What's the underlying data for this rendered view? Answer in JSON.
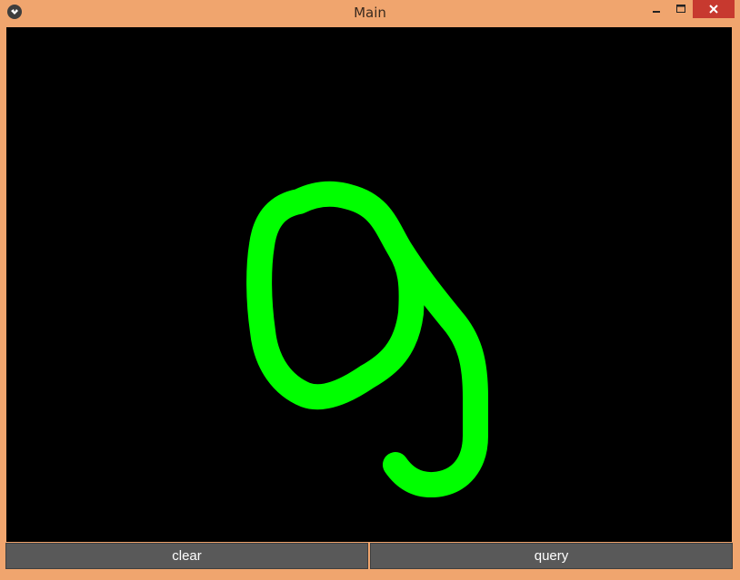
{
  "window": {
    "title": "Main",
    "frame_color": "#f0a56e",
    "close_color": "#c7392f"
  },
  "titlebar_icons": {
    "app": "kivy-app-icon",
    "minimize": "minimize-icon",
    "maximize": "maximize-icon",
    "close": "close-icon"
  },
  "canvas": {
    "background": "#000000",
    "stroke_color": "#00ff00",
    "content": "handwritten digit drawing"
  },
  "buttons": {
    "clear_label": "clear",
    "query_label": "query"
  }
}
